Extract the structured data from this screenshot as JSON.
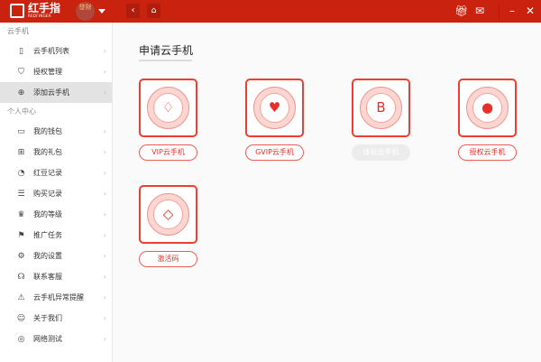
{
  "app": {
    "logo_text": "红手指",
    "logo_sub": "REDFINGER",
    "avatar_text": "發財"
  },
  "sidebar": {
    "section1": "云手机",
    "items1": [
      {
        "label": "云手机列表",
        "icon": "phone-icon"
      },
      {
        "label": "授权管理",
        "icon": "shield-icon"
      },
      {
        "label": "添加云手机",
        "icon": "plus-circle-icon",
        "selected": true
      }
    ],
    "section2": "个人中心",
    "items2": [
      {
        "label": "我的钱包",
        "icon": "wallet-icon"
      },
      {
        "label": "我的礼包",
        "icon": "gift-icon"
      },
      {
        "label": "红豆记录",
        "icon": "bean-icon"
      },
      {
        "label": "购买记录",
        "icon": "list-icon"
      },
      {
        "label": "我的等级",
        "icon": "crown-icon"
      },
      {
        "label": "推广任务",
        "icon": "flag-icon"
      },
      {
        "label": "我的设置",
        "icon": "gear-icon"
      },
      {
        "label": "联系客服",
        "icon": "headset-icon"
      },
      {
        "label": "云手机异常提醒",
        "icon": "alert-icon"
      },
      {
        "label": "关于我们",
        "icon": "smile-icon"
      },
      {
        "label": "网络测试",
        "icon": "network-icon"
      }
    ]
  },
  "main": {
    "title": "申请云手机",
    "cards": [
      {
        "label": "VIP云手机",
        "icon": "diamond-icon",
        "glyph": "♢"
      },
      {
        "label": "GVIP云手机",
        "icon": "heart-icon",
        "glyph": "♥"
      },
      {
        "label": "体验云手机",
        "icon": "badge-b-icon",
        "glyph": "B",
        "disabled": true
      },
      {
        "label": "授权云手机",
        "icon": "bulb-icon",
        "glyph": "●"
      },
      {
        "label": "激活码",
        "icon": "gem-icon",
        "glyph": "◇"
      }
    ]
  },
  "colors": {
    "header": "#c9220f",
    "accent": "#e8302a"
  }
}
